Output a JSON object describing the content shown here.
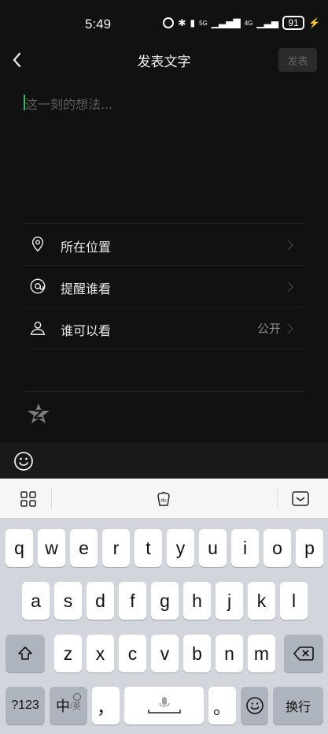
{
  "status": {
    "time": "5:49",
    "network_5g": "5G",
    "network_4g": "4G",
    "battery": "91"
  },
  "header": {
    "title": "发表文字",
    "publish": "发表"
  },
  "compose": {
    "placeholder": "这一刻的想法..."
  },
  "options": {
    "location": "所在位置",
    "remind": "提醒谁看",
    "visibility": "谁可以看",
    "visibility_value": "公开"
  },
  "keyboard": {
    "row1": [
      "q",
      "w",
      "e",
      "r",
      "t",
      "y",
      "u",
      "i",
      "o",
      "p"
    ],
    "row2": [
      "a",
      "s",
      "d",
      "f",
      "g",
      "h",
      "j",
      "k",
      "l"
    ],
    "row3": [
      "z",
      "x",
      "c",
      "v",
      "b",
      "n",
      "m"
    ],
    "symbols": "?123",
    "lang_main": "中",
    "lang_sub": "/英",
    "comma": "，",
    "period": "。",
    "enter": "换行"
  },
  "colors": {
    "accent": "#20c560",
    "background": "#111111"
  }
}
